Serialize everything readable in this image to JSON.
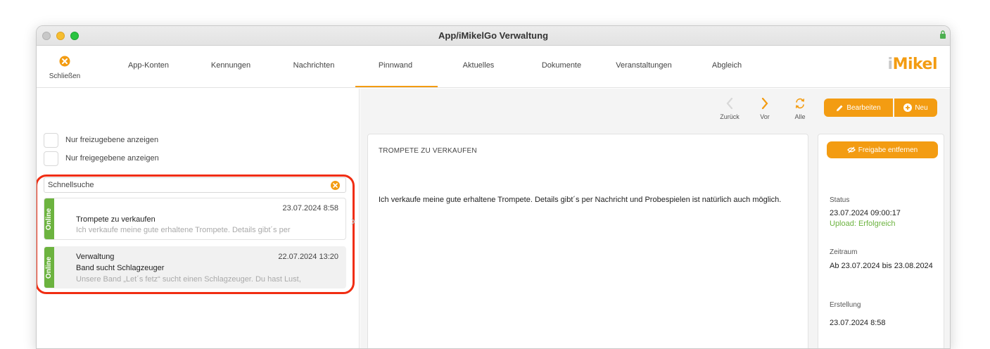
{
  "window": {
    "title": "App/iMikelGo Verwaltung"
  },
  "toolbar": {
    "close_label": "Schließen",
    "tabs": [
      {
        "label": "App-Konten"
      },
      {
        "label": "Kennungen"
      },
      {
        "label": "Nachrichten"
      },
      {
        "label": "Pinnwand",
        "active": true
      },
      {
        "label": "Aktuelles"
      },
      {
        "label": "Dokumente"
      },
      {
        "label": "Veranstaltungen"
      },
      {
        "label": "Abgleich"
      }
    ],
    "logo": {
      "prefix": "i",
      "name": "Mikel"
    }
  },
  "filters": {
    "only_to_release": "Nur freizugebene anzeigen",
    "only_released": "Nur freigegebene anzeigen"
  },
  "search": {
    "placeholder": "Schnellsuche",
    "value": ""
  },
  "list": [
    {
      "status": "Online",
      "date": "23.07.2024 8:58",
      "line1": "Trompete zu verkaufen",
      "preview": "Ich verkaufe meine gute erhaltene Trompete. Details gibt´s per",
      "selected": false
    },
    {
      "status": "Online",
      "date": "22.07.2024 13:20",
      "category": "Verwaltung",
      "line1": "Band sucht Schlagzeuger",
      "preview": "Unsere Band „Let´s fetz“ sucht einen Schlagzeuger. Du hast Lust,",
      "selected": true
    }
  ],
  "nav": {
    "back": "Zurück",
    "forward": "Vor",
    "all": "Alle"
  },
  "actions": {
    "edit": "Bearbeiten",
    "new": "Neu",
    "unrelease": "Freigabe entfernen"
  },
  "detail": {
    "title": "TROMPETE ZU VERKAUFEN",
    "body": "Ich verkaufe meine gute erhaltene Trompete. Details gibt´s per Nachricht und Probespielen ist natürlich auch möglich."
  },
  "meta": {
    "status_label": "Status",
    "status_value": "23.07.2024 09:00:17",
    "upload_status": "Upload: Erfolgreich",
    "period_label": "Zeitraum",
    "period_value": "Ab 23.07.2024 bis 23.08.2024",
    "created_label": "Erstellung",
    "created_value": "23.07.2024 8:58"
  },
  "colors": {
    "accent": "#f39c12",
    "online": "#6cb33f",
    "highlight": "#f02d12"
  }
}
